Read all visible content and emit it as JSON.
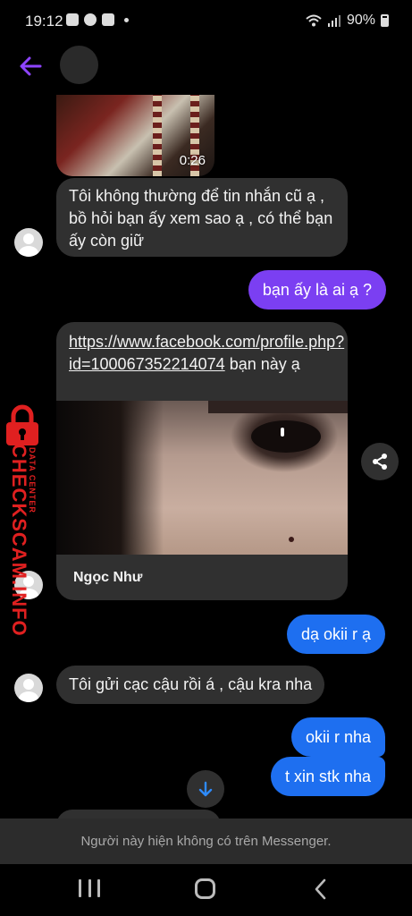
{
  "status_bar": {
    "time": "19:12",
    "battery": "90%"
  },
  "colors": {
    "accent_purple": "#7b3ff2",
    "accent_blue": "#1e6ff0",
    "incoming_bubble": "#303030",
    "watermark_red": "#e02020"
  },
  "messages": {
    "video_duration": "0:26",
    "m1": "Tôi không thường để tin nhắn cũ ạ , bồ hỏi bạn ấy xem sao ạ , có thể bạn ấy còn giữ",
    "m2": "bạn ấy là ai ạ ?",
    "link_url": "https://www.facebook.com/profile.php?id=100067352214074",
    "link_suffix": " bạn này ạ",
    "link_name": "Ngọc Như",
    "m3": "dạ okii r ạ",
    "m4": "Tôi gửi cạc cậu rồi á , cậu kra nha",
    "m5": "okii r nha",
    "m6": "t xin stk nha"
  },
  "watermark": {
    "main": "CHECKSCAM.INFO",
    "sub": "DATA CENTER"
  },
  "notice": "Người này hiện không có trên Messenger.",
  "icons": [
    "back-arrow-icon",
    "share-icon",
    "scroll-down-icon",
    "nav-recent-icon",
    "nav-home-icon",
    "nav-back-icon",
    "lock-icon"
  ]
}
